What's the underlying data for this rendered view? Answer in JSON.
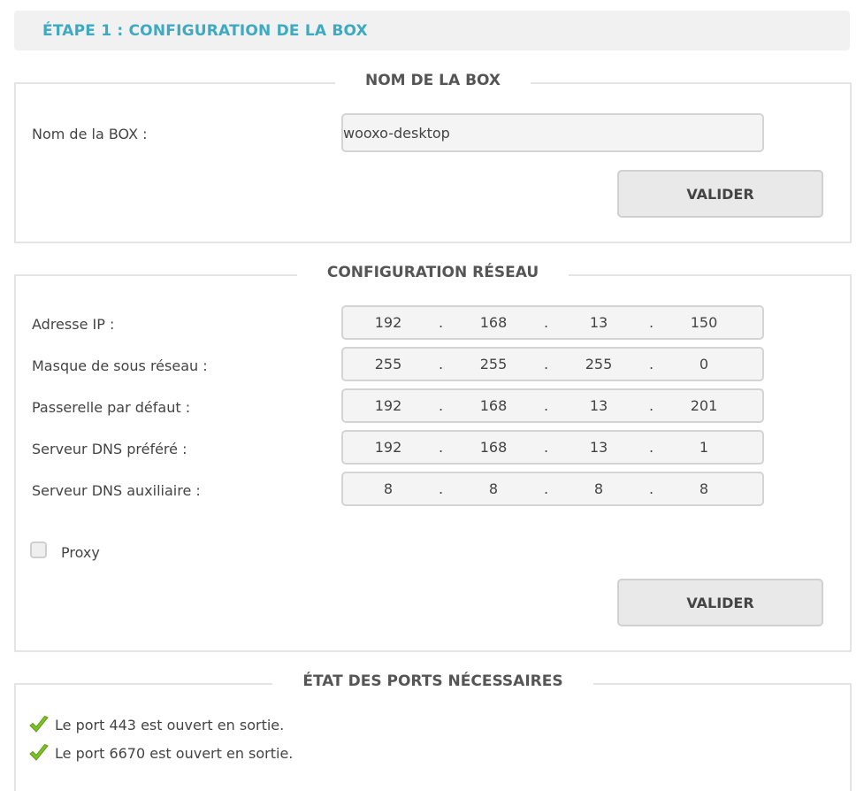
{
  "header": {
    "title": "ÉTAPE 1 : CONFIGURATION DE LA BOX"
  },
  "box_name_section": {
    "legend": "NOM DE LA BOX",
    "label": "Nom de la BOX :",
    "value": "wooxo-desktop",
    "submit_label": "VALIDER"
  },
  "network_section": {
    "legend": "CONFIGURATION RÉSEAU",
    "fields": [
      {
        "label": "Adresse IP :",
        "octets": [
          "192",
          "168",
          "13",
          "150"
        ]
      },
      {
        "label": "Masque de sous réseau :",
        "octets": [
          "255",
          "255",
          "255",
          "0"
        ]
      },
      {
        "label": "Passerelle par défaut :",
        "octets": [
          "192",
          "168",
          "13",
          "201"
        ]
      },
      {
        "label": "Serveur DNS préféré :",
        "octets": [
          "192",
          "168",
          "13",
          "1"
        ]
      },
      {
        "label": "Serveur DNS auxiliaire :",
        "octets": [
          "8",
          "8",
          "8",
          "8"
        ]
      }
    ],
    "separator": ".",
    "proxy_label": "Proxy",
    "proxy_checked": false,
    "submit_label": "VALIDER"
  },
  "ports_section": {
    "legend": "ÉTAT DES PORTS NÉCESSAIRES",
    "status_icon": "check-icon",
    "check_color": "#7cc224",
    "items": [
      "Le port 443 est ouvert en sortie.",
      "Le port 6670 est ouvert en sortie."
    ]
  }
}
